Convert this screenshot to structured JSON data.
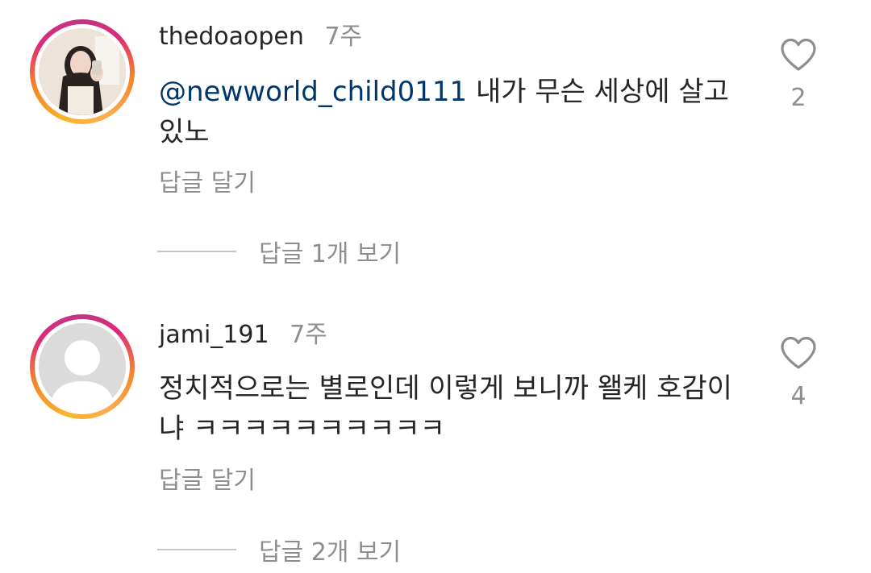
{
  "comments": [
    {
      "username": "thedoaopen",
      "time": "7주",
      "mention": "@newworld_child0111",
      "text": " 내가 무슨 세상에 살고 있노",
      "reply_label": "답글 달기",
      "view_replies_label": "답글 1개 보기",
      "like_count": "2",
      "avatar_type": "photo"
    },
    {
      "username": "jami_191",
      "time": "7주",
      "mention": "",
      "text": "정치적으로는 별로인데 이렇게 보니까 왤케 호감이냐 ㅋㅋㅋㅋㅋㅋㅋㅋㅋㅋ",
      "reply_label": "답글 달기",
      "view_replies_label": "답글 2개 보기",
      "like_count": "4",
      "avatar_type": "default"
    }
  ],
  "colors": {
    "text": "#262626",
    "secondary": "#8e8e8e",
    "mention": "#00376b",
    "story_ring": [
      "#f7b52c",
      "#f58529",
      "#dd2a7b",
      "#c13584"
    ]
  },
  "icons": {
    "like": "heart-outline-icon",
    "default_avatar": "default-user-icon"
  }
}
